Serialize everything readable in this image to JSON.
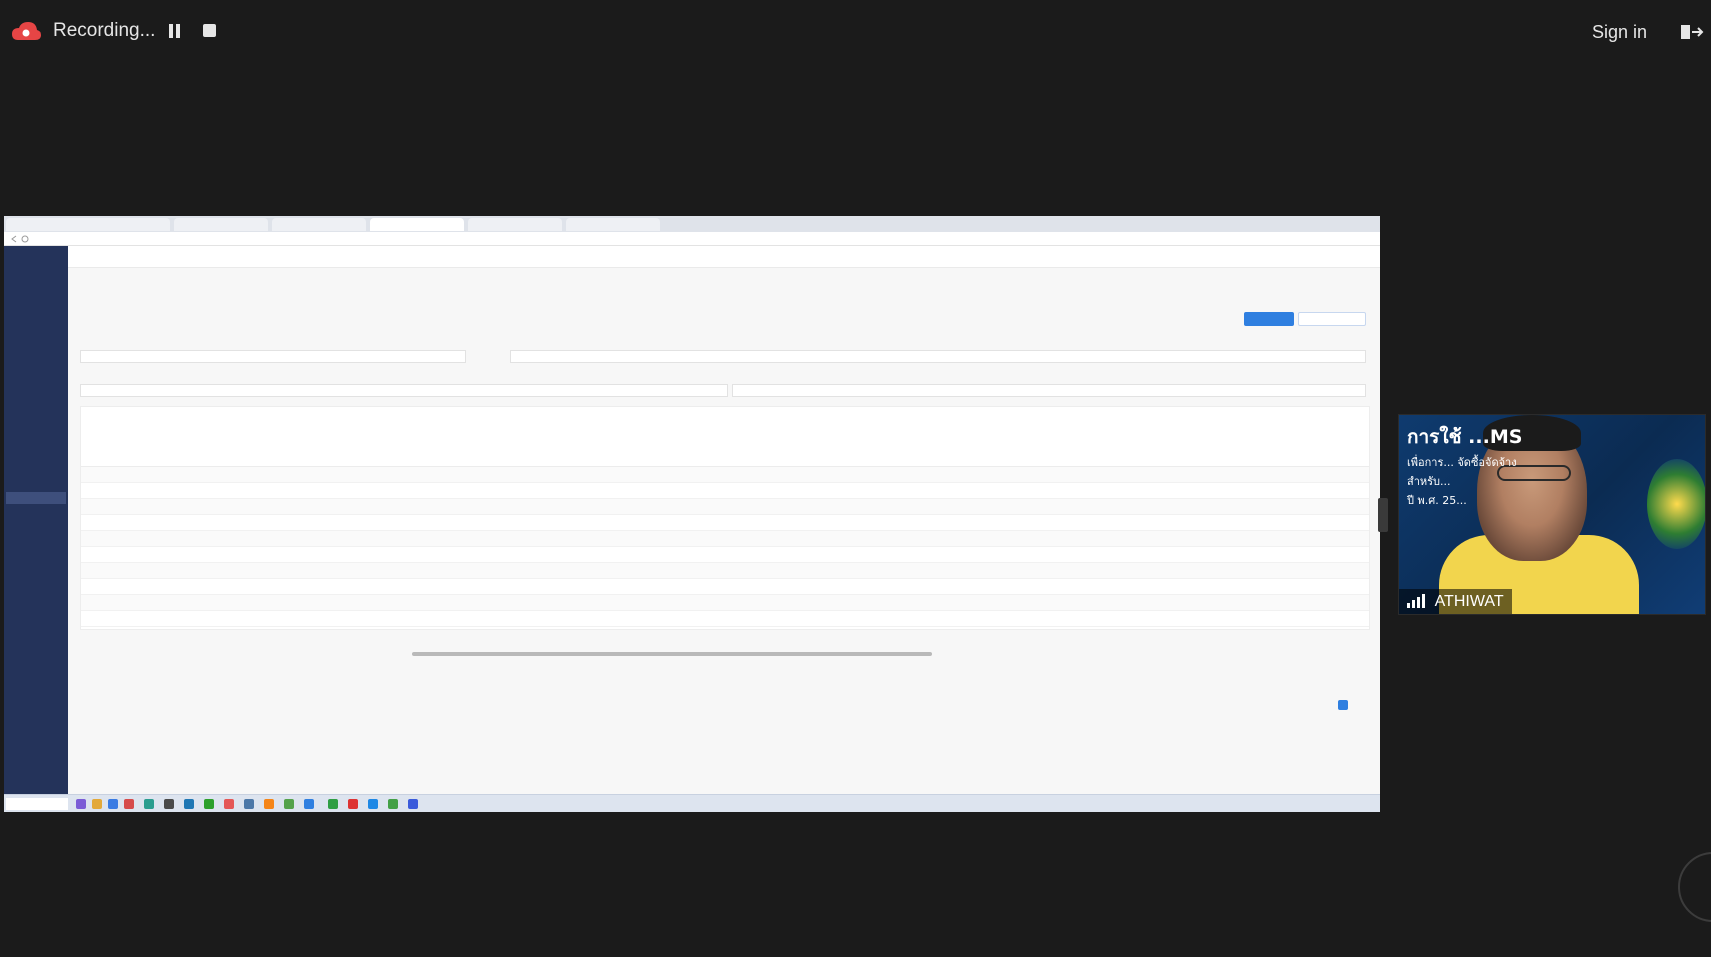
{
  "recording": {
    "status_label": "Recording...",
    "sign_in_label": "Sign in"
  },
  "participant": {
    "name": "ATHIWAT",
    "banner_text": "การใช้ ...MS",
    "banner_sub1": "เพื่อการ... จัดซื้อจัดจ้าง",
    "banner_sub2": "สำหรับ...",
    "banner_sub3": "ปี พ.ศ. 25..."
  }
}
